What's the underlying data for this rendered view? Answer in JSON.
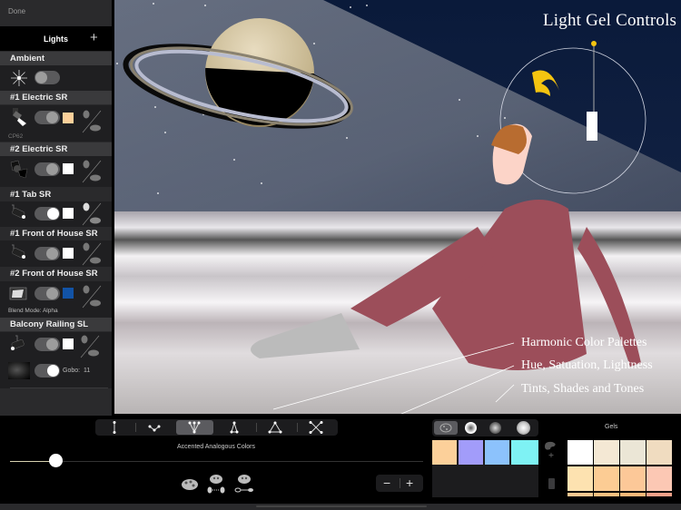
{
  "sidebar": {
    "done_label": "Done",
    "header_title": "Lights",
    "add_label": "+",
    "lights": [
      {
        "name": "Ambient",
        "fixture_icon": "starburst-icon",
        "toggle": "off",
        "gel_color": null,
        "sub_label": null
      },
      {
        "name": "#1 Electric SR",
        "fixture_icon": "spotlight-icon",
        "toggle": "mid",
        "gel_color": "#fcd09a",
        "sub_label": "CP62"
      },
      {
        "name": "#2 Electric SR",
        "fixture_icon": "fresnel-barndoor-icon",
        "toggle": "mid",
        "gel_color": "#ffffff",
        "sub_label": null
      },
      {
        "name": "#1 Tab SR",
        "fixture_icon": "ellipsoidal-icon",
        "toggle": "on",
        "gel_color": "#ffffff",
        "sub_label": null
      },
      {
        "name": "#1 Front of House SR",
        "fixture_icon": "ellipsoidal-icon",
        "toggle": "mid",
        "gel_color": "#ffffff",
        "sub_label": null
      },
      {
        "name": "#2 Front of House SR",
        "fixture_icon": "floodlight-icon",
        "toggle": "mid",
        "gel_color": "#1253a6",
        "sub_label": "Blend Mode:  Alpha"
      },
      {
        "name": "Balcony Railing SL",
        "fixture_icon": "ellipsoidal-icon",
        "toggle": "mid",
        "gel_color": "#ffffff",
        "sub_label": null
      }
    ],
    "gobo": {
      "label": "Gobo:",
      "value": "11",
      "toggle": "on"
    }
  },
  "stage": {
    "title": "Light Gel Controls",
    "annotations": [
      "Harmonic Color Palettes",
      "Hue, Satuation, Lightness",
      "Tints, Shades and Tones"
    ],
    "intensity_slider_value": 0.3
  },
  "bottom": {
    "harmony_modes": [
      {
        "icon": "complementary-icon",
        "selected": false
      },
      {
        "icon": "split-icon",
        "selected": false
      },
      {
        "icon": "accented-analogous-icon",
        "selected": true
      },
      {
        "icon": "triad-narrow-icon",
        "selected": false
      },
      {
        "icon": "triad-icon",
        "selected": false
      },
      {
        "icon": "tetrad-icon",
        "selected": false
      }
    ],
    "scheme_label": "Accented Analogous Colors",
    "slider_value": 0.11,
    "palette_modes": [
      "palette-icon",
      "palette-to-light-icon",
      "palette-to-gobo-icon"
    ],
    "stepper": {
      "minus": "−",
      "plus": "+"
    },
    "palette_tabs": [
      "palette-tab-icon",
      "spot-hard-icon",
      "spot-soft-icon",
      "spot-glow-icon"
    ],
    "palette_colors": [
      "#fcd09a",
      "#a29cfa",
      "#8cc2fc",
      "#7ef2f4"
    ],
    "gels_label": "Gels",
    "gels": [
      "#ffffff",
      "#f4e8d4",
      "#ebe6d6",
      "#f0dcc0",
      "#fde2b0",
      "#fccc94",
      "#fcc898",
      "#fcc8b4",
      "#fcc890",
      "#fcc080",
      "#fcb878",
      "#f4a088"
    ]
  }
}
